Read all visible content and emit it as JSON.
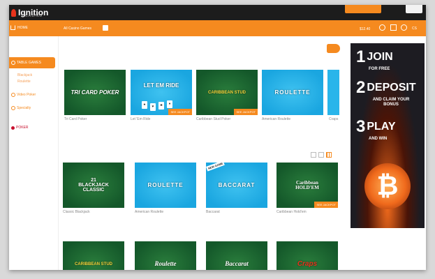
{
  "brand": {
    "name": "Ignition",
    "sub": "CASINO"
  },
  "nav": {
    "home": "HOME",
    "category": "All Casino Games",
    "balance": "$12.40",
    "mini_label": "CS"
  },
  "sidebar": {
    "table_games": "TABLE GAMES",
    "sub1": "Blackjack",
    "sub2": "Roulette",
    "item3": "Video Poker",
    "item4": "Specialty",
    "poker": "POKER"
  },
  "tiles_row1": [
    {
      "logo": "TRI CARD POKER",
      "label": "Tri Card Poker",
      "color": "green",
      "badge": ""
    },
    {
      "logo": "LET EM RIDE",
      "label": "Let 'Em Ride",
      "color": "blue",
      "badge": "SEE JACKPOT"
    },
    {
      "logo": "CARIBBEAN STUD",
      "label": "Caribbean Stud Poker",
      "color": "green",
      "badge": "SEE JACKPOT"
    },
    {
      "logo": "ROULETTE",
      "label": "American Roulette",
      "color": "blue",
      "badge": ""
    }
  ],
  "partial_label": "Craps",
  "tiles_row2": [
    {
      "logo": "21 BLACKJACK CLASSIC",
      "label": "Classic Blackjack",
      "color": "green",
      "badge": "",
      "new": ""
    },
    {
      "logo": "ROULETTE",
      "label": "American Roulette",
      "color": "blue",
      "badge": "",
      "new": ""
    },
    {
      "logo": "BACCARAT",
      "label": "Baccarat",
      "color": "blue",
      "badge": "",
      "new": "NEW GAME"
    },
    {
      "logo": "Caribbean HOLD'EM",
      "label": "Caribbean Hold'em",
      "color": "green",
      "badge": "SEE JACKPOT",
      "new": ""
    }
  ],
  "tiles_row3": [
    {
      "logo": "CARIBBEAN STUD",
      "color": "green"
    },
    {
      "logo": "Roulette",
      "color": "green"
    },
    {
      "logo": "Baccarat",
      "color": "green"
    },
    {
      "logo": "Craps",
      "color": "green"
    }
  ],
  "banner": {
    "step1": {
      "num": "1",
      "word": "JOIN",
      "sub": "FOR FREE"
    },
    "step2": {
      "num": "2",
      "word": "DEPOSIT",
      "sub": "AND CLAIM YOUR BONUS"
    },
    "step3": {
      "num": "3",
      "word": "PLAY",
      "sub": "AND WIN"
    },
    "coin": "₿"
  },
  "colors": {
    "accent": "#f58a1f",
    "green_felt": "#1f6f35",
    "blue_tile": "#29b5ea"
  }
}
